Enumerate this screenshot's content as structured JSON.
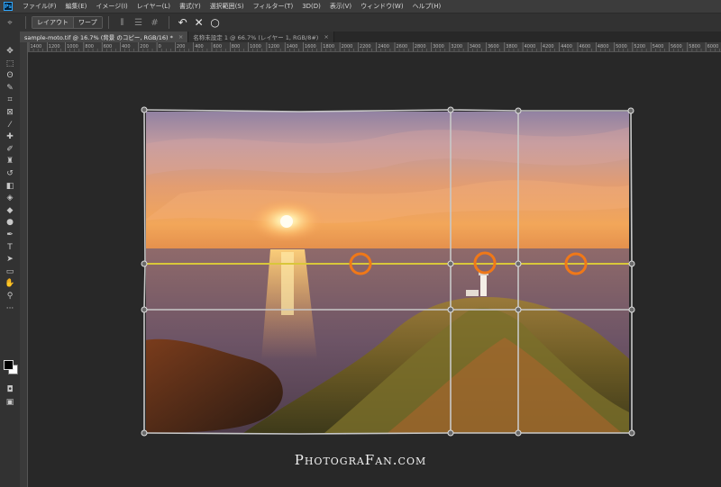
{
  "app": {
    "logo_text": "Ps"
  },
  "menubar": {
    "items": [
      "ファイル(F)",
      "編集(E)",
      "イメージ(I)",
      "レイヤー(L)",
      "書式(Y)",
      "選択範囲(S)",
      "フィルター(T)",
      "3D(D)",
      "表示(V)",
      "ウィンドウ(W)",
      "ヘルプ(H)"
    ]
  },
  "options": {
    "layout_label": "レイアウト",
    "warp_label": "ワープ"
  },
  "tabs": [
    {
      "label": "sample-moto.tif @ 16.7% (背景 のコピー, RGB/16) *",
      "active": true
    },
    {
      "label": "名称未設定 1 @ 66.7% (レイヤー 1, RGB/8#)",
      "active": false
    }
  ],
  "ruler": {
    "labels": [
      "1400",
      "1200",
      "1000",
      "800",
      "600",
      "400",
      "200",
      "0",
      "200",
      "400",
      "600",
      "800",
      "1000",
      "1200",
      "1400",
      "1600",
      "1800",
      "2000",
      "2200",
      "2400",
      "2600",
      "2800",
      "3000",
      "3200",
      "3400",
      "3600",
      "3800",
      "4000",
      "4200",
      "4400",
      "4600",
      "4800",
      "5000",
      "5200",
      "5400",
      "5600",
      "5800",
      "6000"
    ]
  },
  "tools": [
    {
      "name": "move-tool",
      "glyph": "✥"
    },
    {
      "name": "marquee-tool",
      "glyph": "⬚"
    },
    {
      "name": "lasso-tool",
      "glyph": "ʘ"
    },
    {
      "name": "quick-select-tool",
      "glyph": "✎"
    },
    {
      "name": "crop-tool",
      "glyph": "⌗"
    },
    {
      "name": "frame-tool",
      "glyph": "⊠"
    },
    {
      "name": "eyedropper-tool",
      "glyph": "⁄"
    },
    {
      "name": "healing-tool",
      "glyph": "✚"
    },
    {
      "name": "brush-tool",
      "glyph": "✐"
    },
    {
      "name": "stamp-tool",
      "glyph": "♜"
    },
    {
      "name": "history-brush-tool",
      "glyph": "↺"
    },
    {
      "name": "eraser-tool",
      "glyph": "◧"
    },
    {
      "name": "gradient-tool",
      "glyph": "◈"
    },
    {
      "name": "blur-tool",
      "glyph": "◆"
    },
    {
      "name": "dodge-tool",
      "glyph": "●"
    },
    {
      "name": "pen-tool",
      "glyph": "✒"
    },
    {
      "name": "type-tool",
      "glyph": "T"
    },
    {
      "name": "path-select-tool",
      "glyph": "➤"
    },
    {
      "name": "shape-tool",
      "glyph": "▭"
    },
    {
      "name": "hand-tool",
      "glyph": "✋"
    },
    {
      "name": "zoom-tool",
      "glyph": "⚲"
    },
    {
      "name": "more-tools",
      "glyph": "···"
    }
  ],
  "colors": {
    "grid": "#c8c8c8",
    "horizon_line": "#d9c73a",
    "marker": "#f07818"
  },
  "watermark": {
    "text": "PhotograFan.com"
  }
}
